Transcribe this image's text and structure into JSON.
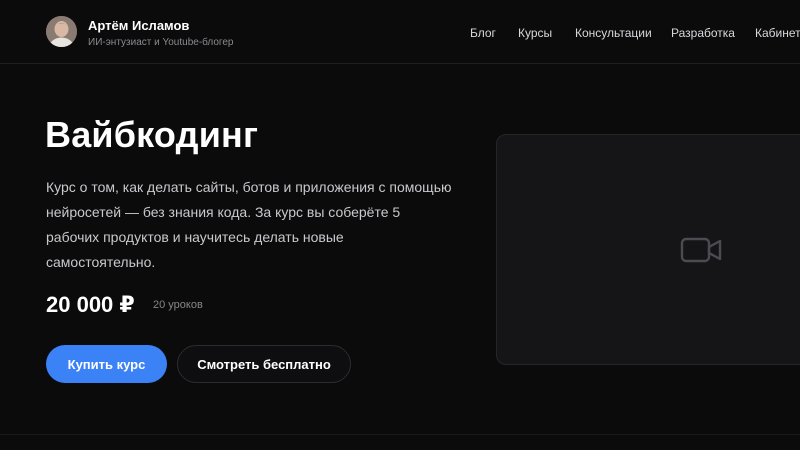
{
  "header": {
    "author_name": "Артём Исламов",
    "author_subtitle": "ИИ-энтузиаст и Youtube-блогер",
    "nav": [
      {
        "label": "Блог"
      },
      {
        "label": "Курсы"
      },
      {
        "label": "Консультации"
      },
      {
        "label": "Разработка"
      },
      {
        "label": "Кабинет"
      }
    ]
  },
  "hero": {
    "title": "Вайбкодинг",
    "description_lines": [
      "Курс о том, как делать сайты, ботов и приложения с помощью",
      "нейросетей — без знания кода. За курс вы соберёте 5",
      "рабочих продуктов и научитесь делать новые",
      "самостоятельно."
    ],
    "price": "20 000 ₽",
    "lessons": "20 уроков",
    "buy_label": "Купить курс",
    "watch_free_label": "Смотреть бесплатно"
  },
  "video": {
    "icon": "video-camera-icon"
  },
  "colors": {
    "background": "#0b0b0c",
    "accent": "#3b82f6",
    "card": "#151517"
  }
}
